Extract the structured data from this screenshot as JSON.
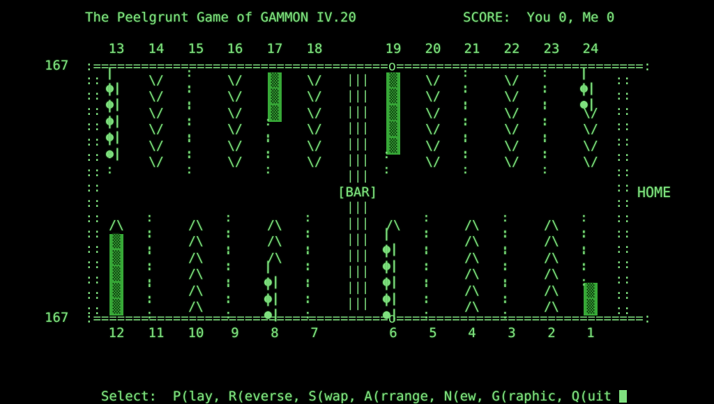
{
  "header": {
    "title": "The Peelgrunt Game of GAMMON IV.20",
    "score": "SCORE:  You 0, Me 0"
  },
  "pip_counts": {
    "top": "167",
    "bottom": "167"
  },
  "labels": {
    "bar": "[BAR]",
    "home": "HOME"
  },
  "top_points": [
    "13",
    "14",
    "15",
    "16",
    "17",
    "18",
    "19",
    "20",
    "21",
    "22",
    "23",
    "24"
  ],
  "bottom_points": [
    "12",
    "11",
    "10",
    "9",
    "8",
    "7",
    "6",
    "5",
    "4",
    "3",
    "2",
    "1"
  ],
  "top_stacks": [
    [
      "o",
      "o",
      "o",
      "o",
      "o",
      ".."
    ],
    [
      "v",
      "v",
      "v",
      "v",
      "v",
      "v"
    ],
    [
      "..",
      "..",
      "..",
      "..",
      "..",
      ".."
    ],
    [
      "v",
      "v",
      "v",
      "v",
      "v",
      "v"
    ],
    [
      "x",
      "x",
      "x",
      "..",
      "..",
      ".."
    ],
    [
      "v",
      "v",
      "v",
      "v",
      "v",
      "v"
    ],
    [
      "x",
      "x",
      "x",
      "x",
      "x",
      ".."
    ],
    [
      "v",
      "v",
      "v",
      "v",
      "v",
      "v"
    ],
    [
      "..",
      "..",
      "..",
      "..",
      "..",
      ".."
    ],
    [
      "v",
      "v",
      "v",
      "v",
      "v",
      "v"
    ],
    [
      "..",
      "..",
      "..",
      "..",
      "..",
      ".."
    ],
    [
      "o",
      "o",
      "v",
      "v",
      "v",
      "v"
    ]
  ],
  "bottom_stacks": [
    [
      "^",
      "x",
      "x",
      "x",
      "x",
      "x"
    ],
    [
      "..",
      "..",
      "..",
      "..",
      "..",
      ".."
    ],
    [
      "^",
      "^",
      "^",
      "^",
      "^",
      "^"
    ],
    [
      "..",
      "..",
      "..",
      "..",
      "..",
      ".."
    ],
    [
      "^",
      "^",
      "^",
      "o",
      "o",
      "o"
    ],
    [
      "..",
      "..",
      "..",
      "..",
      "..",
      ".."
    ],
    [
      "^",
      "o",
      "o",
      "o",
      "o",
      "o"
    ],
    [
      "..",
      "..",
      "..",
      "..",
      "..",
      ".."
    ],
    [
      "^",
      "^",
      "^",
      "^",
      "^",
      "^"
    ],
    [
      "..",
      "..",
      "..",
      "..",
      "..",
      ".."
    ],
    [
      "^",
      "^",
      "^",
      "^",
      "^",
      "^"
    ],
    [
      "..",
      "..",
      "..",
      "..",
      "x",
      "x"
    ]
  ],
  "menu": {
    "prompt": "Select:",
    "options": "P(lay, R(everse, S(wap, A(rrange, N(ew, G(raphic, Q(uit"
  }
}
